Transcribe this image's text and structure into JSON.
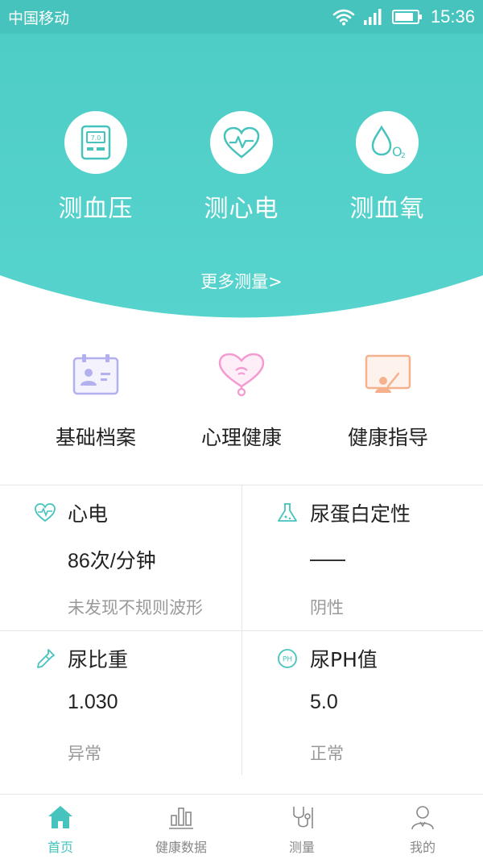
{
  "status_bar": {
    "carrier": "中国移动",
    "time": "15:36",
    "icons": [
      "wifi-icon",
      "signal-icon",
      "battery-icon"
    ]
  },
  "colors": {
    "accent": "#46c3bc",
    "header_bg": "#52d0ca",
    "purple": "#b3b0ef",
    "pink": "#f49ad2",
    "orange": "#f5b18e",
    "muted": "#999999"
  },
  "header": {
    "measurements": [
      {
        "label": "测血压",
        "icon": "blood-pressure-monitor-icon"
      },
      {
        "label": "测心电",
        "icon": "heart-ecg-icon"
      },
      {
        "label": "测血氧",
        "icon": "blood-oxygen-drop-icon"
      }
    ],
    "monitor_text": "7.0",
    "oxygen_text": "O",
    "oxygen_sub": "2",
    "more_label": "更多测量>"
  },
  "quick_links": [
    {
      "label": "基础档案",
      "icon": "profile-card-icon"
    },
    {
      "label": "心理健康",
      "icon": "psych-heart-stethoscope-icon"
    },
    {
      "label": "健康指导",
      "icon": "teacher-board-icon"
    }
  ],
  "metrics": [
    {
      "title": "心电",
      "value": "86次/分钟",
      "status": "未发现不规则波形",
      "icon": "heart-ecg-small-icon"
    },
    {
      "title": "尿蛋白定性",
      "value": "——",
      "status": "阴性",
      "icon": "flask-icon"
    },
    {
      "title": "尿比重",
      "value": "1.030",
      "status": "异常",
      "icon": "dropper-icon"
    },
    {
      "title": "尿PH值",
      "value": "5.0",
      "status": "正常",
      "icon": "ph-icon",
      "icon_text": "PH"
    }
  ],
  "tabs": [
    {
      "label": "首页",
      "icon": "home-icon",
      "active": true
    },
    {
      "label": "健康数据",
      "icon": "bar-chart-icon",
      "active": false
    },
    {
      "label": "测量",
      "icon": "stethoscope-icon",
      "active": false
    },
    {
      "label": "我的",
      "icon": "doctor-user-icon",
      "active": false
    }
  ]
}
